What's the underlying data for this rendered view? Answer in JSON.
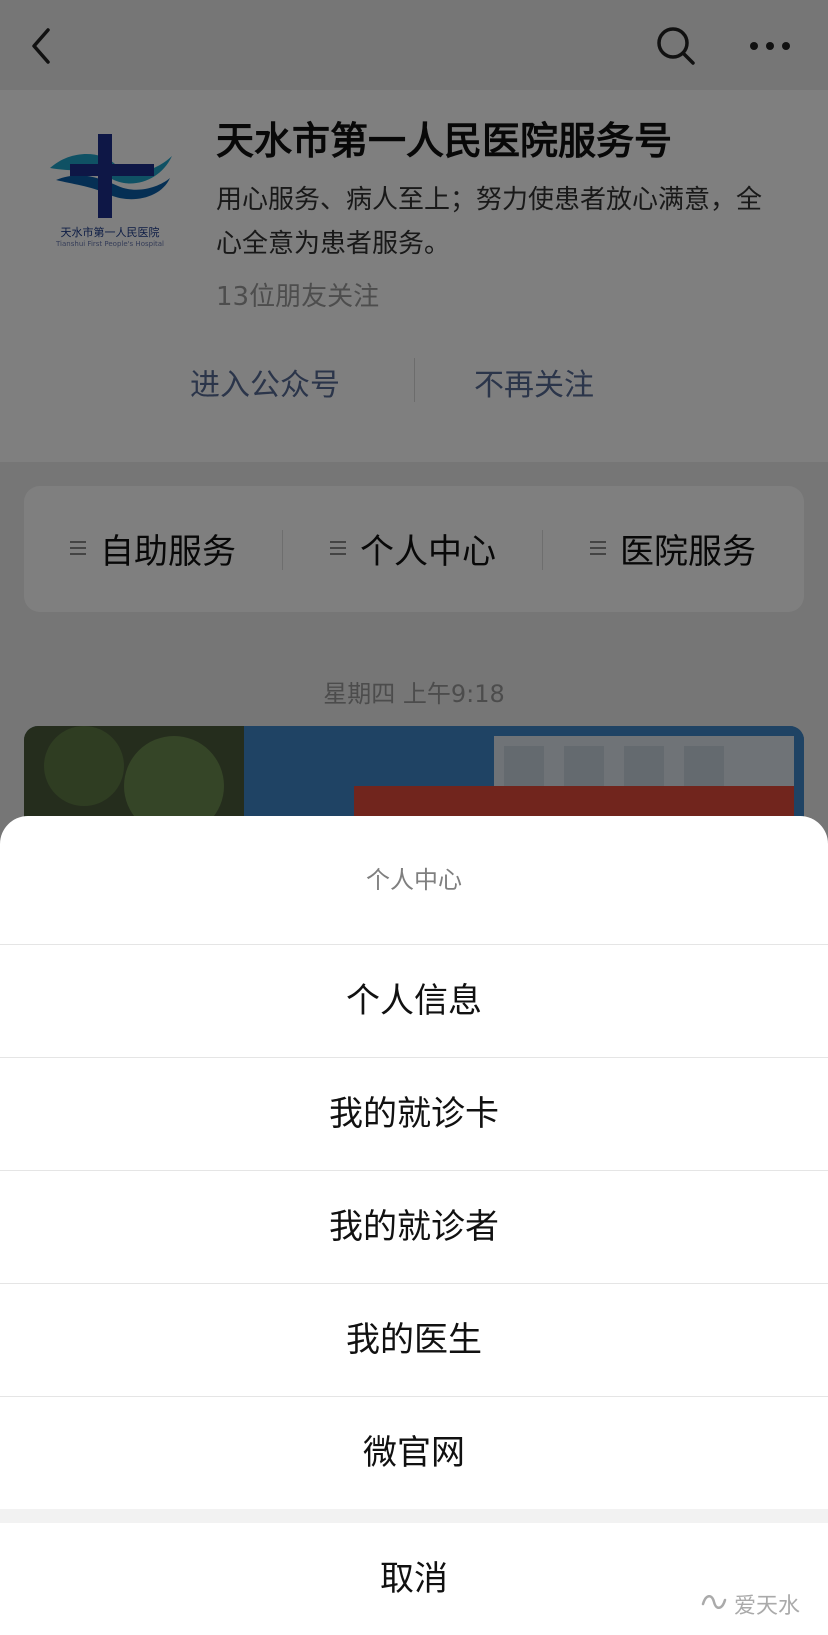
{
  "header": {
    "back_icon": "chevron-left-icon",
    "search_icon": "search-icon",
    "more_icon": "more-dots-icon"
  },
  "profile": {
    "logo_text": "天水市第一人民医院",
    "logo_sub": "Tianshui First People's Hospital",
    "name": "天水市第一人民医院服务号",
    "description": "用心服务、病人至上；努力使患者放心满意，全心全意为患者服务。",
    "followers": "13位朋友关注",
    "enter_label": "进入公众号",
    "unfollow_label": "不再关注"
  },
  "menu": {
    "items": [
      {
        "label": "自助服务",
        "icon": "menu-lines-icon"
      },
      {
        "label": "个人中心",
        "icon": "menu-lines-icon"
      },
      {
        "label": "医院服务",
        "icon": "menu-lines-icon"
      }
    ]
  },
  "feed": {
    "timestamp": "星期四 上午9:18"
  },
  "sheet": {
    "title": "个人中心",
    "options": [
      "个人信息",
      "我的就诊卡",
      "我的就诊者",
      "我的医生",
      "微官网"
    ],
    "cancel_label": "取消"
  },
  "watermark": {
    "text": "爱天水",
    "icon": "wechat-channel-icon"
  },
  "colors": {
    "link": "#576b95",
    "overlay": "rgba(0,0,0,0.5)",
    "background": "#ededed"
  }
}
